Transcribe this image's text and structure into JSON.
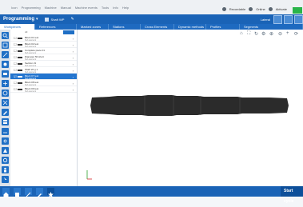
{
  "menu": [
    "Icon",
    "Programming",
    "Machine",
    "Manual",
    "Machine events",
    "Tools",
    "Info",
    "Help"
  ],
  "topbar": {
    "item1": "Recordable",
    "item2": "Online",
    "user": "Aktivate"
  },
  "program": {
    "title": "Programming",
    "file": "Shaft WP"
  },
  "right_group_label": "Lateral",
  "tabs": [
    "Workpieces",
    "References",
    "Marked zones",
    "Stations",
    "Cross Elements",
    "Dynamic methods",
    "Profiles",
    "Segments"
  ],
  "sidebar_list_label": "All",
  "sidebar_items": [
    {
      "name": "Block 01 test",
      "sub": "Sub element"
    },
    {
      "name": "Block 02 test",
      "sub": "Sub element"
    },
    {
      "name": "Complete piece 01",
      "sub": "Sub element"
    },
    {
      "name": "Diameter 50 short",
      "sub": "Sub element"
    },
    {
      "name": "Section 21",
      "sub": "Sub element"
    },
    {
      "name": "Shaft 22 g 1",
      "sub": "Sub element"
    },
    {
      "name": "Block 07 test",
      "sub": "Sub element"
    },
    {
      "name": "Block 08 test",
      "sub": "Sub element"
    },
    {
      "name": "Block 09 test",
      "sub": "Sub element"
    }
  ],
  "selected_index": 6,
  "start_label": "Start cycle",
  "colors": {
    "primary": "#1a63b6",
    "accent": "#29b44a",
    "part": "#2a2a2a"
  },
  "viewport_tools": [
    "home-icon",
    "zoom-fit-icon",
    "rotate-icon",
    "settings-icon",
    "zoom-in-icon",
    "add-icon",
    "refresh-icon"
  ],
  "tool_icons": [
    "search-icon",
    "grid-icon",
    "arrow-icon",
    "tool-icon",
    "select-icon",
    "zoom-icon",
    "add-icon",
    "move-icon",
    "pen-icon",
    "layers-icon",
    "measure-icon",
    "cut-icon",
    "shape-icon",
    "settings-icon",
    "person-icon",
    "cursor-icon"
  ]
}
